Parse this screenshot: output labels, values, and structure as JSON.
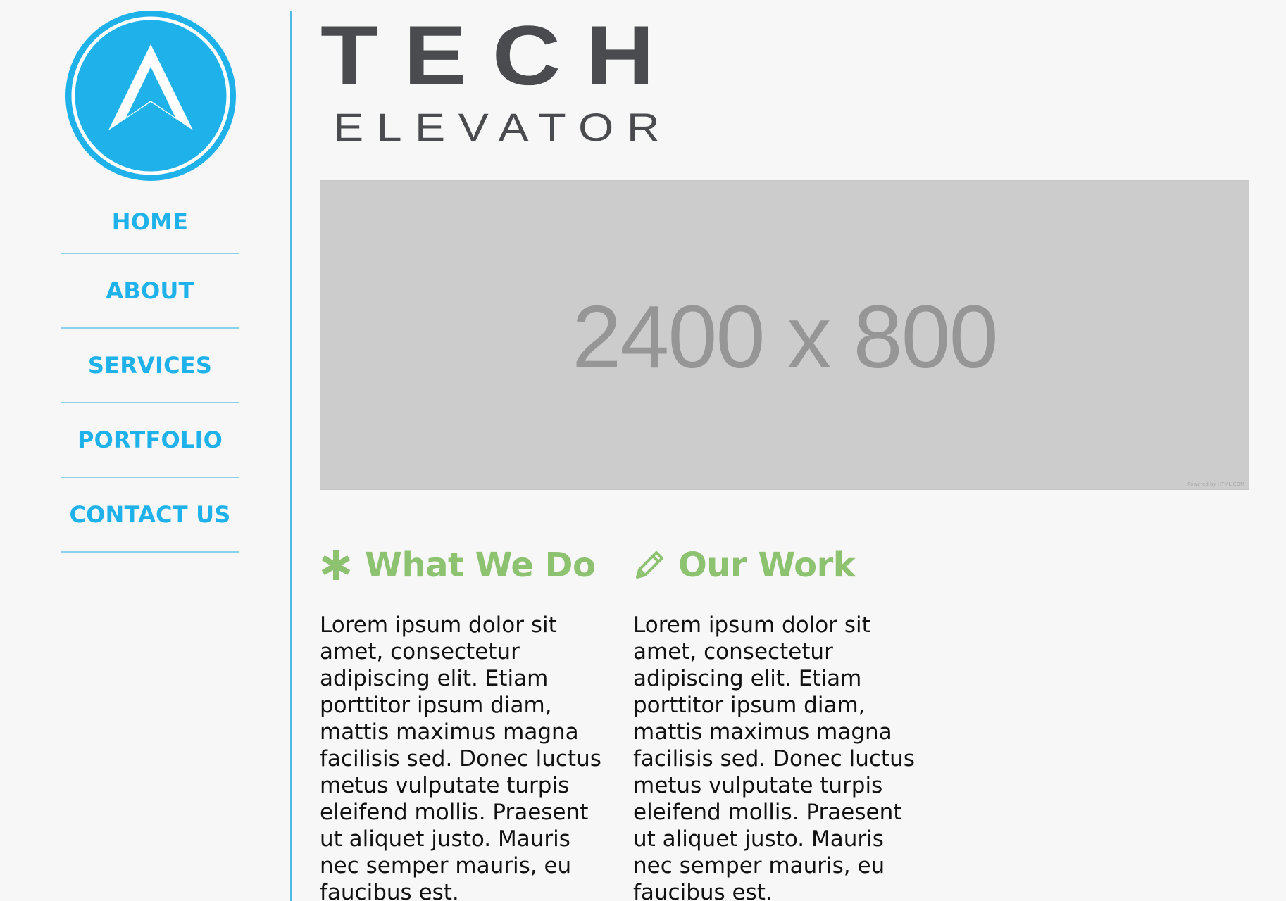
{
  "brand": {
    "wordmark_top": "TECH",
    "wordmark_bottom": "ELEVATOR",
    "accent_color": "#1fb2ea",
    "heading_color": "#8cc270",
    "logo_icon": "arrow-up-icon"
  },
  "nav": {
    "items": [
      {
        "label": "HOME"
      },
      {
        "label": "ABOUT"
      },
      {
        "label": "SERVICES"
      },
      {
        "label": "PORTFOLIO"
      },
      {
        "label": "CONTACT US"
      }
    ]
  },
  "hero": {
    "placeholder_text": "2400 x 800",
    "powered_by": "Powered by HTML.COM"
  },
  "sections": [
    {
      "icon": "asterisk-icon",
      "heading": "What We Do",
      "body": "Lorem ipsum dolor sit amet, consectetur adipiscing elit. Etiam porttitor ipsum diam, mattis maximus magna facilisis sed. Donec luctus metus vulputate turpis eleifend mollis. Praesent ut aliquet justo. Mauris nec semper mauris, eu faucibus est."
    },
    {
      "icon": "pencil-icon",
      "heading": "Our Work",
      "body": "Lorem ipsum dolor sit amet, consectetur adipiscing elit. Etiam porttitor ipsum diam, mattis maximus magna facilisis sed. Donec luctus metus vulputate turpis eleifend mollis. Praesent ut aliquet justo. Mauris nec semper mauris, eu faucibus est."
    }
  ]
}
